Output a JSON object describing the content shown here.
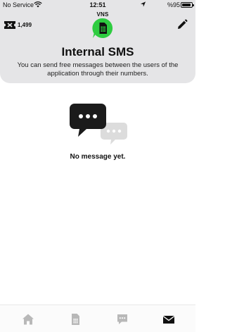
{
  "status_bar": {
    "carrier": "No Service",
    "time": "12:51",
    "battery": "%95"
  },
  "header": {
    "credits": "1,499",
    "brand": "VNS",
    "title": "Internal SMS",
    "subtitle": "You can send free messages between the users of the application through their numbers."
  },
  "empty_state": {
    "text": "No message yet."
  },
  "tab_bar": {
    "tabs": [
      {
        "icon": "home-icon",
        "active": false
      },
      {
        "icon": "sim-card-icon",
        "active": false
      },
      {
        "icon": "chat-icon",
        "active": false
      },
      {
        "icon": "envelope-icon",
        "active": true
      }
    ]
  },
  "colors": {
    "header_bg": "#e5e5e7",
    "brand_green": "#2ecc40",
    "inactive_icon": "#b8b8b8",
    "active_icon": "#111111"
  }
}
